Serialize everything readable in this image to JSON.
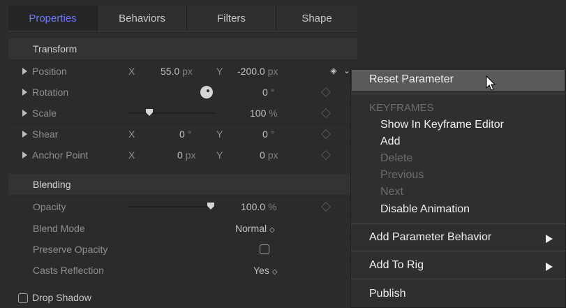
{
  "tabs": [
    "Properties",
    "Behaviors",
    "Filters",
    "Shape"
  ],
  "transform": {
    "header": "Transform",
    "position": {
      "label": "Position",
      "x_label": "X",
      "x_value": "55.0",
      "x_unit": "px",
      "y_label": "Y",
      "y_value": "-200.0",
      "y_unit": "px"
    },
    "rotation": {
      "label": "Rotation",
      "value": "0",
      "unit": "°"
    },
    "scale": {
      "label": "Scale",
      "value": "100",
      "unit": "%"
    },
    "shear": {
      "label": "Shear",
      "x_label": "X",
      "x_value": "0",
      "x_unit": "°",
      "y_label": "Y",
      "y_value": "0",
      "y_unit": "°"
    },
    "anchor": {
      "label": "Anchor Point",
      "x_label": "X",
      "x_value": "0",
      "x_unit": "px",
      "y_label": "Y",
      "y_value": "0",
      "y_unit": "px"
    }
  },
  "blending": {
    "header": "Blending",
    "opacity": {
      "label": "Opacity",
      "value": "100.0",
      "unit": "%"
    },
    "blend_mode": {
      "label": "Blend Mode",
      "value": "Normal"
    },
    "preserve_opacity": {
      "label": "Preserve Opacity"
    },
    "casts_reflection": {
      "label": "Casts Reflection",
      "value": "Yes"
    }
  },
  "drop_shadow": {
    "label": "Drop Shadow"
  },
  "menu": {
    "reset": "Reset Parameter",
    "keyframes_header": "KEYFRAMES",
    "show_in_keyframe": "Show In Keyframe Editor",
    "add": "Add",
    "delete": "Delete",
    "previous": "Previous",
    "next": "Next",
    "disable_animation": "Disable Animation",
    "add_param_behavior": "Add Parameter Behavior",
    "add_to_rig": "Add To Rig",
    "publish": "Publish"
  },
  "colors": {
    "accent": "#6c78ff",
    "menu_highlight": "#5a5a5a"
  }
}
